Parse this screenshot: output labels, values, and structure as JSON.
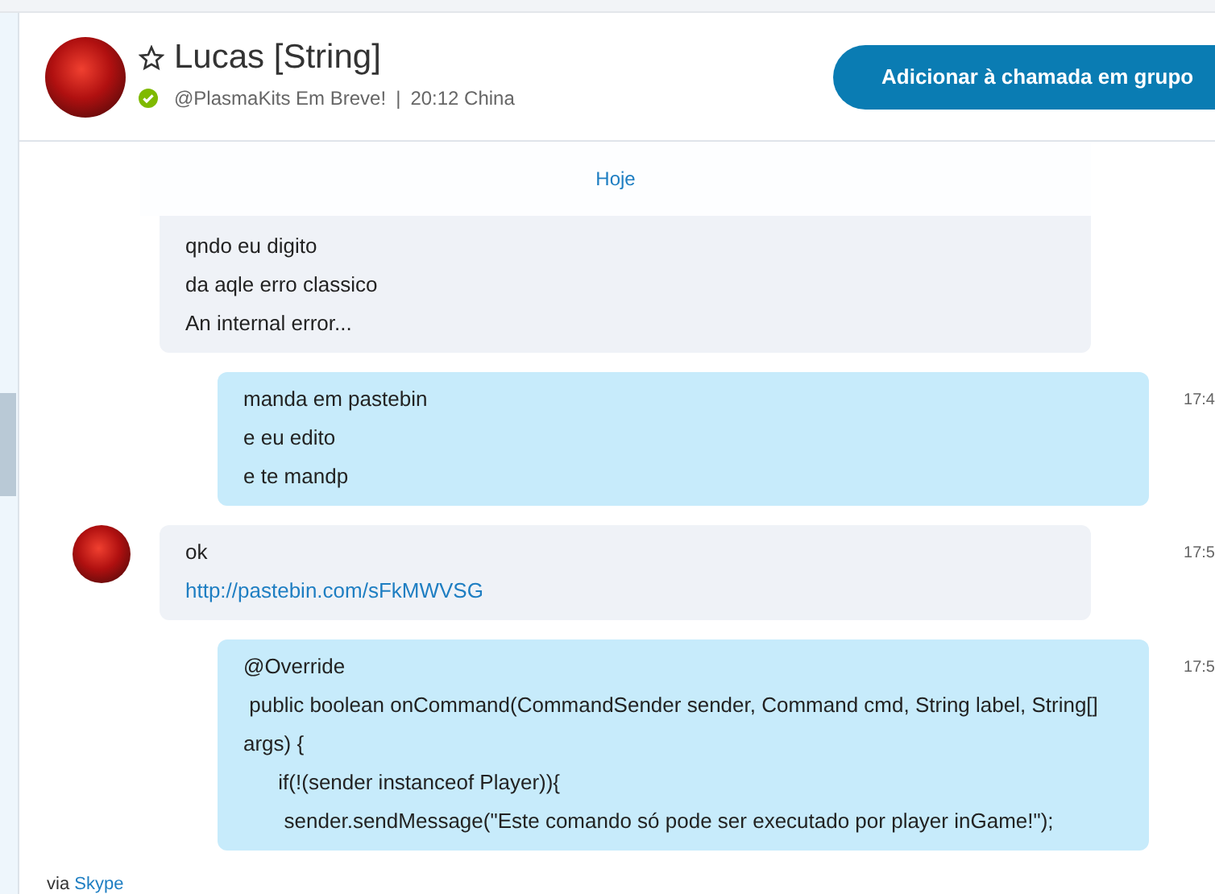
{
  "header": {
    "name": "Lucas [String]",
    "favorite": false,
    "online": true,
    "mood": "@PlasmaKits Em Breve!",
    "separator": "|",
    "local_time": "20:12 China",
    "button": "Adicionar à chamada em grupo"
  },
  "date_divider": "Hoje",
  "messages": [
    {
      "kind": "incoming",
      "avatar": false,
      "lines": [
        {
          "text": "qndo eu digito"
        },
        {
          "text": "da aqle erro classico"
        },
        {
          "text": "An internal error..."
        }
      ]
    },
    {
      "kind": "outgoing",
      "time": "17:4",
      "lines": [
        {
          "text": "manda em pastebin"
        },
        {
          "text": "e eu edito"
        },
        {
          "text": "e te mandp"
        }
      ]
    },
    {
      "kind": "incoming",
      "avatar": true,
      "time": "17:5",
      "lines": [
        {
          "text": "ok"
        },
        {
          "text": "http://pastebin.com/sFkMWVSG",
          "link": true
        }
      ]
    },
    {
      "kind": "outgoing",
      "time": "17:5",
      "lines": [
        {
          "text": "@Override"
        },
        {
          "text": " public boolean onCommand(CommandSender sender, Command cmd, String label, String[] args) {"
        },
        {
          "text": "      if(!(sender instanceof Player)){"
        },
        {
          "text": "       sender.sendMessage(\"Este comando só pode ser executado por player inGame!\");"
        }
      ]
    }
  ],
  "footer": {
    "prefix": "via",
    "link": "Skype"
  }
}
